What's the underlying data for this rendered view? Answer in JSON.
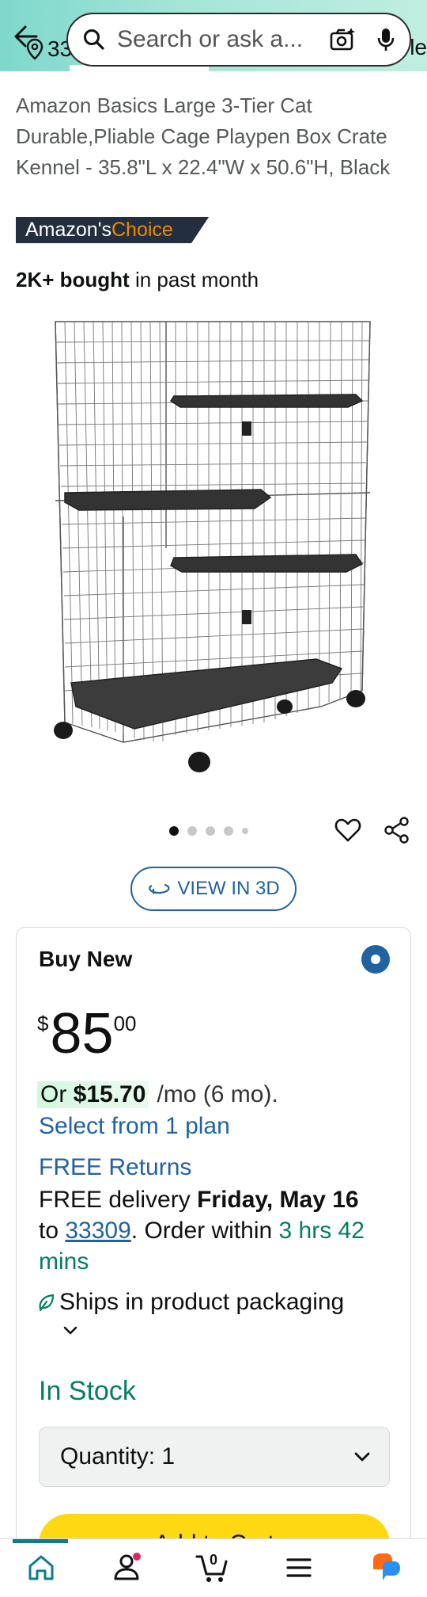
{
  "header": {
    "location_peek": "33",
    "right_peek": "le",
    "search_placeholder": "Search or ask a..."
  },
  "product": {
    "title": "Amazon Basics Large 3-Tier Cat Durable,Pliable Cage Playpen Box Crate Kennel - 35.8\"L x 22.4\"W x 50.6\"H, Black",
    "badge_prefix": "Amazon's",
    "badge_suffix": "Choice",
    "bought_bold": "2K+ bought",
    "bought_rest": " in past month",
    "image_alt": "black wire three-tier cat cage",
    "view_3d": "VIEW IN 3D"
  },
  "gallery": {
    "total": 5,
    "active": 0
  },
  "buybox": {
    "heading": "Buy New",
    "price_symbol": "$",
    "price_whole": "85",
    "price_fraction": "00",
    "monthly_or": "Or ",
    "monthly_amount": "$15.70",
    "monthly_rest": "/mo (6 mo).",
    "plan_link": "Select from 1 plan",
    "free_returns": "FREE Returns",
    "delivery_prefix": "FREE delivery ",
    "delivery_date": "Friday, May 16",
    "delivery_to": "to ",
    "zip": "33309",
    "order_within": ". Order within ",
    "countdown": "3 hrs 42 mins",
    "ships": "Ships in product packaging",
    "stock": "In Stock",
    "quantity_label": "Quantity: 1",
    "add_to_cart": "Add to Cart"
  },
  "bottom_nav": {
    "cart_count": "0",
    "items": [
      "home-icon",
      "account-icon",
      "cart-icon",
      "menu-icon",
      "rufus-icon"
    ]
  },
  "colors": {
    "link": "#2162a1",
    "green": "#067d62",
    "badge_bg": "#232f3e",
    "badge_orange": "#f08804",
    "cart_button": "#ffd814",
    "header_gradient_start": "#7fd8cc"
  }
}
